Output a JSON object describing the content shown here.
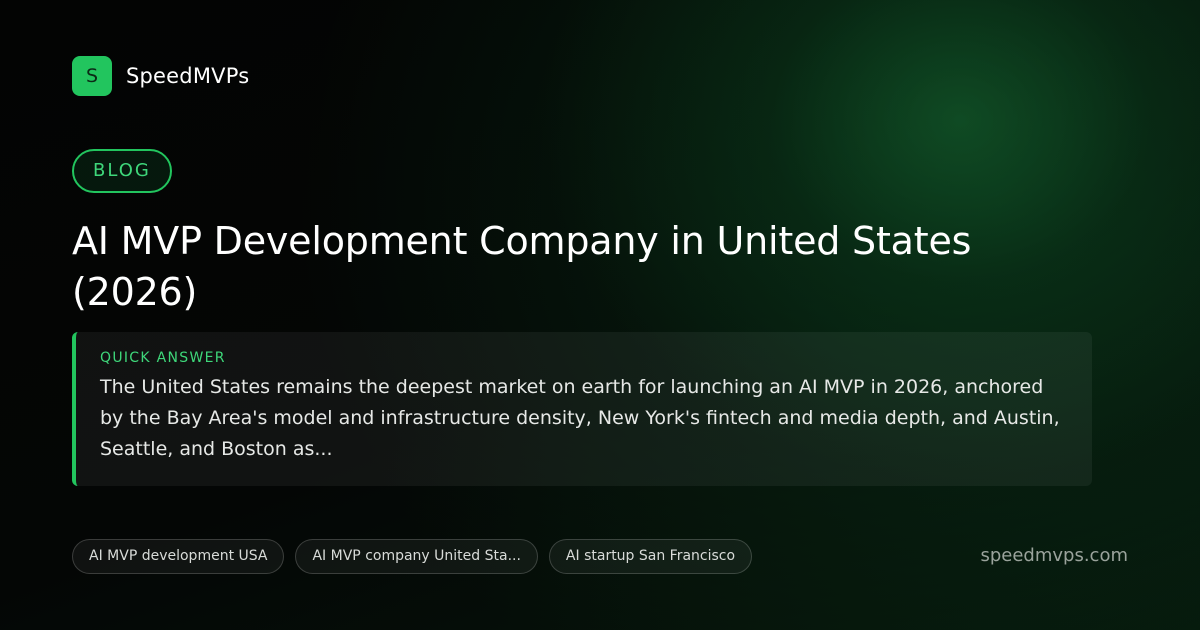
{
  "brand": {
    "logo_letter": "S",
    "name": "SpeedMVPs"
  },
  "category": "BLOG",
  "title": "AI MVP Development Company in United States (2026)",
  "quick_answer": {
    "label": "QUICK ANSWER",
    "text": "The United States remains the deepest market on earth for launching an AI MVP in 2026, anchored by the Bay Area's model and infrastructure density, New York's fintech and media depth, and Austin, Seattle, and Boston as..."
  },
  "tags": [
    {
      "label": "AI MVP development USA"
    },
    {
      "label": "AI MVP company United Sta..."
    },
    {
      "label": "AI startup San Francisco"
    }
  ],
  "site_url": "speedmvps.com",
  "colors": {
    "accent": "#22c55e",
    "background": "#050605"
  }
}
